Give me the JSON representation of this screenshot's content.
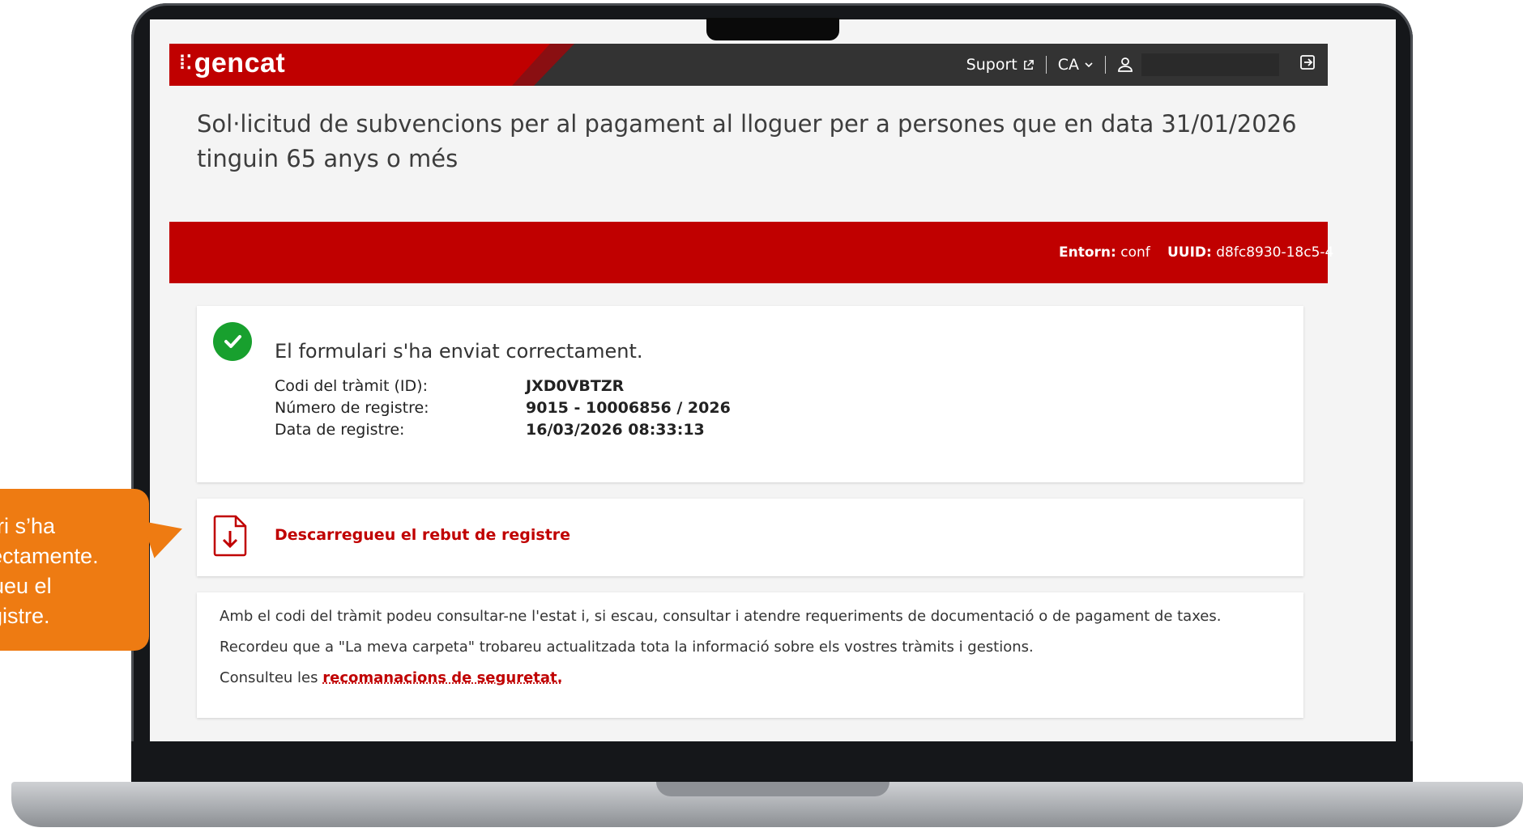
{
  "header": {
    "logo": "gencat",
    "support_label": "Suport",
    "language": "CA"
  },
  "page_title": "Sol·licitud de subvencions per al pagament al lloguer per a persones que en data 31/01/2026 tinguin 65 anys o més",
  "environment": {
    "env_label": "Entorn:",
    "env_value": "conf",
    "uuid_label": "UUID:",
    "uuid_value": "d8fc8930-18c5-4"
  },
  "confirmation": {
    "message": "El formulari s'ha enviat correctament.",
    "fields": [
      {
        "label": "Codi del tràmit (ID):",
        "value": "JXD0VBTZR"
      },
      {
        "label": "Número de registre:",
        "value": "9015 - 10006856 / 2026"
      },
      {
        "label": "Data de registre:",
        "value": "16/03/2026 08:33:13"
      }
    ]
  },
  "download": {
    "label": "Descarregueu el rebut de registre"
  },
  "info": {
    "line1": "Amb el codi del tràmit podeu consultar-ne l'estat i, si escau, consultar i atendre requeriments de documentació o de pagament de taxes.",
    "line2": "Recordeu que a \"La meva carpeta\" trobareu actualitzada tota la informació sobre els vostres tràmits i gestions.",
    "line3_prefix": "Consulteu les",
    "line3_link": "recomanacions de seguretat."
  },
  "callout": {
    "lines": [
      "ri s’ha",
      "ectamente.",
      "ueu el",
      "gistre."
    ]
  },
  "colors": {
    "brand_red": "#c00000",
    "success_green": "#18a02e",
    "callout_orange": "#ee7b12"
  }
}
